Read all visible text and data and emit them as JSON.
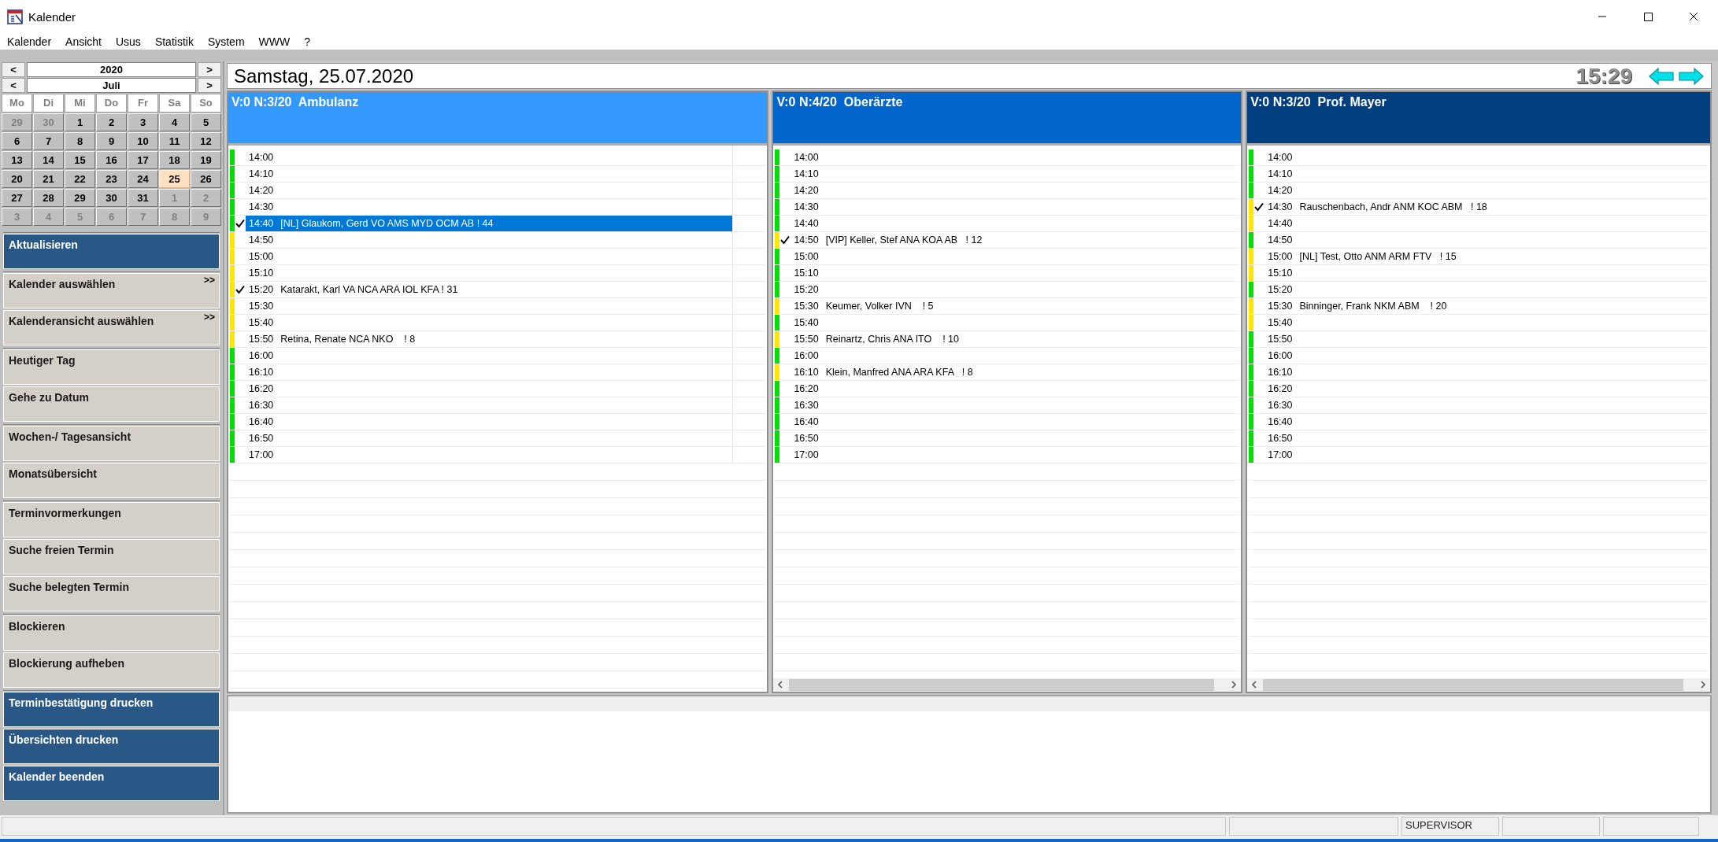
{
  "window": {
    "title": "Kalender"
  },
  "menu": [
    "Kalender",
    "Ansicht",
    "Usus",
    "Statistik",
    "System",
    "WWW",
    "?"
  ],
  "calendar": {
    "year": "2020",
    "month": "Juli",
    "year_prev": "<",
    "year_next": ">",
    "month_prev": "<",
    "month_next": ">",
    "weekdays": [
      "Mo",
      "Di",
      "Mi",
      "Do",
      "Fr",
      "Sa",
      "So"
    ],
    "days": [
      {
        "label": "29",
        "in_month": false,
        "selected": false
      },
      {
        "label": "30",
        "in_month": false,
        "selected": false
      },
      {
        "label": "1",
        "in_month": true,
        "selected": false
      },
      {
        "label": "2",
        "in_month": true,
        "selected": false
      },
      {
        "label": "3",
        "in_month": true,
        "selected": false
      },
      {
        "label": "4",
        "in_month": true,
        "selected": false
      },
      {
        "label": "5",
        "in_month": true,
        "selected": false
      },
      {
        "label": "6",
        "in_month": true,
        "selected": false
      },
      {
        "label": "7",
        "in_month": true,
        "selected": false
      },
      {
        "label": "8",
        "in_month": true,
        "selected": false
      },
      {
        "label": "9",
        "in_month": true,
        "selected": false
      },
      {
        "label": "10",
        "in_month": true,
        "selected": false
      },
      {
        "label": "11",
        "in_month": true,
        "selected": false
      },
      {
        "label": "12",
        "in_month": true,
        "selected": false
      },
      {
        "label": "13",
        "in_month": true,
        "selected": false
      },
      {
        "label": "14",
        "in_month": true,
        "selected": false
      },
      {
        "label": "15",
        "in_month": true,
        "selected": false
      },
      {
        "label": "16",
        "in_month": true,
        "selected": false
      },
      {
        "label": "17",
        "in_month": true,
        "selected": false
      },
      {
        "label": "18",
        "in_month": true,
        "selected": false
      },
      {
        "label": "19",
        "in_month": true,
        "selected": false
      },
      {
        "label": "20",
        "in_month": true,
        "selected": false
      },
      {
        "label": "21",
        "in_month": true,
        "selected": false
      },
      {
        "label": "22",
        "in_month": true,
        "selected": false
      },
      {
        "label": "23",
        "in_month": true,
        "selected": false
      },
      {
        "label": "24",
        "in_month": true,
        "selected": false
      },
      {
        "label": "25",
        "in_month": true,
        "selected": true
      },
      {
        "label": "26",
        "in_month": true,
        "selected": false
      },
      {
        "label": "27",
        "in_month": true,
        "selected": false
      },
      {
        "label": "28",
        "in_month": true,
        "selected": false
      },
      {
        "label": "29",
        "in_month": true,
        "selected": false
      },
      {
        "label": "30",
        "in_month": true,
        "selected": false
      },
      {
        "label": "31",
        "in_month": true,
        "selected": false
      },
      {
        "label": "1",
        "in_month": false,
        "selected": false
      },
      {
        "label": "2",
        "in_month": false,
        "selected": false
      },
      {
        "label": "3",
        "in_month": false,
        "selected": false
      },
      {
        "label": "4",
        "in_month": false,
        "selected": false
      },
      {
        "label": "5",
        "in_month": false,
        "selected": false
      },
      {
        "label": "6",
        "in_month": false,
        "selected": false
      },
      {
        "label": "7",
        "in_month": false,
        "selected": false
      },
      {
        "label": "8",
        "in_month": false,
        "selected": false
      },
      {
        "label": "9",
        "in_month": false,
        "selected": false
      }
    ]
  },
  "sidebar": {
    "groups": [
      [
        {
          "label": "Aktualisieren",
          "kind": "action"
        }
      ],
      [
        {
          "label": "Kalender auswählen",
          "kind": "command",
          "more": ">>"
        },
        {
          "label": "Kalenderansicht auswählen",
          "kind": "command",
          "more": ">>"
        }
      ],
      [
        {
          "label": "Heutiger Tag",
          "kind": "command"
        },
        {
          "label": "Gehe zu Datum",
          "kind": "command"
        }
      ],
      [
        {
          "label": "Wochen-/ Tagesansicht",
          "kind": "command"
        },
        {
          "label": "Monatsübersicht",
          "kind": "command"
        }
      ],
      [
        {
          "label": "Terminvormerkungen",
          "kind": "command"
        },
        {
          "label": "Suche freien Termin",
          "kind": "command"
        },
        {
          "label": "Suche belegten Termin",
          "kind": "command"
        }
      ],
      [
        {
          "label": "Blockieren",
          "kind": "command"
        },
        {
          "label": "Blockierung aufheben",
          "kind": "command"
        }
      ],
      [
        {
          "label": "Terminbestätigung drucken",
          "kind": "action"
        },
        {
          "label": "Übersichten drucken",
          "kind": "action"
        },
        {
          "label": "Kalender beenden",
          "kind": "action"
        }
      ]
    ]
  },
  "day_view": {
    "date": "Samstag, 25.07.2020",
    "clock": "15:29",
    "columns": [
      {
        "header": "V:0 N:3/20  Ambulanz",
        "color": "#3399ff",
        "scrollbar": false,
        "slots": [
          {
            "time": "14:00",
            "color": "#00dd00",
            "checked": false,
            "selected": false
          },
          {
            "time": "14:10",
            "color": "#00dd00",
            "checked": false,
            "selected": false
          },
          {
            "time": "14:20",
            "color": "#00dd00",
            "checked": false,
            "selected": false
          },
          {
            "time": "14:30",
            "color": "#00dd00",
            "checked": false,
            "selected": false
          },
          {
            "time": "14:40",
            "text": "[NL] Glaukom, Gerd VO AMS MYD OCM AB ! 44",
            "color": "#00dd00",
            "checked": true,
            "selected": true
          },
          {
            "time": "14:50",
            "color": "#ffe600",
            "checked": false,
            "selected": false
          },
          {
            "time": "15:00",
            "color": "#ffe600",
            "checked": false,
            "selected": false
          },
          {
            "time": "15:10",
            "color": "#ffe600",
            "checked": false,
            "selected": false
          },
          {
            "time": "15:20",
            "text": "Katarakt, Karl VA NCA ARA IOL KFA ! 31",
            "color": "#ffe600",
            "checked": true,
            "selected": false
          },
          {
            "time": "15:30",
            "color": "#ffe600",
            "checked": false,
            "selected": false
          },
          {
            "time": "15:40",
            "color": "#ffe600",
            "checked": false,
            "selected": false
          },
          {
            "time": "15:50",
            "text": "Retina, Renate NCA NKO    ! 8",
            "color": "#ffe600",
            "checked": false,
            "selected": false
          },
          {
            "time": "16:00",
            "color": "#00dd00",
            "checked": false,
            "selected": false
          },
          {
            "time": "16:10",
            "color": "#00dd00",
            "checked": false,
            "selected": false
          },
          {
            "time": "16:20",
            "color": "#00dd00",
            "checked": false,
            "selected": false
          },
          {
            "time": "16:30",
            "color": "#00dd00",
            "checked": false,
            "selected": false
          },
          {
            "time": "16:40",
            "color": "#00dd00",
            "checked": false,
            "selected": false
          },
          {
            "time": "16:50",
            "color": "#00dd00",
            "checked": false,
            "selected": false
          },
          {
            "time": "17:00",
            "color": "#00dd00",
            "checked": false,
            "selected": false
          }
        ]
      },
      {
        "header": "V:0 N:4/20  Oberärzte",
        "color": "#0066cc",
        "scrollbar": true,
        "slots": [
          {
            "time": "14:00",
            "color": "#00dd00",
            "checked": false,
            "selected": false
          },
          {
            "time": "14:10",
            "color": "#00dd00",
            "checked": false,
            "selected": false
          },
          {
            "time": "14:20",
            "color": "#00dd00",
            "checked": false,
            "selected": false
          },
          {
            "time": "14:30",
            "color": "#00dd00",
            "checked": false,
            "selected": false
          },
          {
            "time": "14:40",
            "color": "#00dd00",
            "checked": false,
            "selected": false
          },
          {
            "time": "14:50",
            "text": "[VIP] Keller, Stef ANA KOA AB   ! 12",
            "color": "#ffe600",
            "checked": true,
            "selected": false
          },
          {
            "time": "15:00",
            "color": "#00dd00",
            "checked": false,
            "selected": false
          },
          {
            "time": "15:10",
            "color": "#00dd00",
            "checked": false,
            "selected": false
          },
          {
            "time": "15:20",
            "color": "#00dd00",
            "checked": false,
            "selected": false
          },
          {
            "time": "15:30",
            "text": "Keumer, Volker IVN    ! 5",
            "color": "#ffe600",
            "checked": false,
            "selected": false
          },
          {
            "time": "15:40",
            "color": "#00dd00",
            "checked": false,
            "selected": false
          },
          {
            "time": "15:50",
            "text": "Reinartz, Chris ANA ITO    ! 10",
            "color": "#ffe600",
            "checked": false,
            "selected": false
          },
          {
            "time": "16:00",
            "color": "#00dd00",
            "checked": false,
            "selected": false
          },
          {
            "time": "16:10",
            "text": "Klein, Manfred ANA ARA KFA   ! 8",
            "color": "#ffe600",
            "checked": false,
            "selected": false
          },
          {
            "time": "16:20",
            "color": "#00dd00",
            "checked": false,
            "selected": false
          },
          {
            "time": "16:30",
            "color": "#00dd00",
            "checked": false,
            "selected": false
          },
          {
            "time": "16:40",
            "color": "#00dd00",
            "checked": false,
            "selected": false
          },
          {
            "time": "16:50",
            "color": "#00dd00",
            "checked": false,
            "selected": false
          },
          {
            "time": "17:00",
            "color": "#00dd00",
            "checked": false,
            "selected": false
          }
        ]
      },
      {
        "header": "V:0 N:3/20  Prof. Mayer",
        "color": "#003f7f",
        "scrollbar": true,
        "slots": [
          {
            "time": "14:00",
            "color": "#00dd00",
            "checked": false,
            "selected": false
          },
          {
            "time": "14:10",
            "color": "#00dd00",
            "checked": false,
            "selected": false
          },
          {
            "time": "14:20",
            "color": "#00dd00",
            "checked": false,
            "selected": false
          },
          {
            "time": "14:30",
            "text": "Rauschenbach, Andr ANM KOC ABM   ! 18",
            "color": "#ffe600",
            "checked": true,
            "selected": false
          },
          {
            "time": "14:40",
            "color": "#ffe600",
            "checked": false,
            "selected": false
          },
          {
            "time": "14:50",
            "color": "#00dd00",
            "checked": false,
            "selected": false
          },
          {
            "time": "15:00",
            "text": "[NL] Test, Otto ANM ARM FTV   ! 15",
            "color": "#ffe600",
            "checked": false,
            "selected": false
          },
          {
            "time": "15:10",
            "color": "#ffe600",
            "checked": false,
            "selected": false
          },
          {
            "time": "15:20",
            "color": "#00dd00",
            "checked": false,
            "selected": false
          },
          {
            "time": "15:30",
            "text": "Binninger, Frank NKM ABM    ! 20",
            "color": "#ffe600",
            "checked": false,
            "selected": false
          },
          {
            "time": "15:40",
            "color": "#ffe600",
            "checked": false,
            "selected": false
          },
          {
            "time": "15:50",
            "color": "#00dd00",
            "checked": false,
            "selected": false
          },
          {
            "time": "16:00",
            "color": "#00dd00",
            "checked": false,
            "selected": false
          },
          {
            "time": "16:10",
            "color": "#00dd00",
            "checked": false,
            "selected": false
          },
          {
            "time": "16:20",
            "color": "#00dd00",
            "checked": false,
            "selected": false
          },
          {
            "time": "16:30",
            "color": "#00dd00",
            "checked": false,
            "selected": false
          },
          {
            "time": "16:40",
            "color": "#00dd00",
            "checked": false,
            "selected": false
          },
          {
            "time": "16:50",
            "color": "#00dd00",
            "checked": false,
            "selected": false
          },
          {
            "time": "17:00",
            "color": "#00dd00",
            "checked": false,
            "selected": false
          }
        ]
      }
    ]
  },
  "status_bar": {
    "user": "SUPERVISOR"
  }
}
